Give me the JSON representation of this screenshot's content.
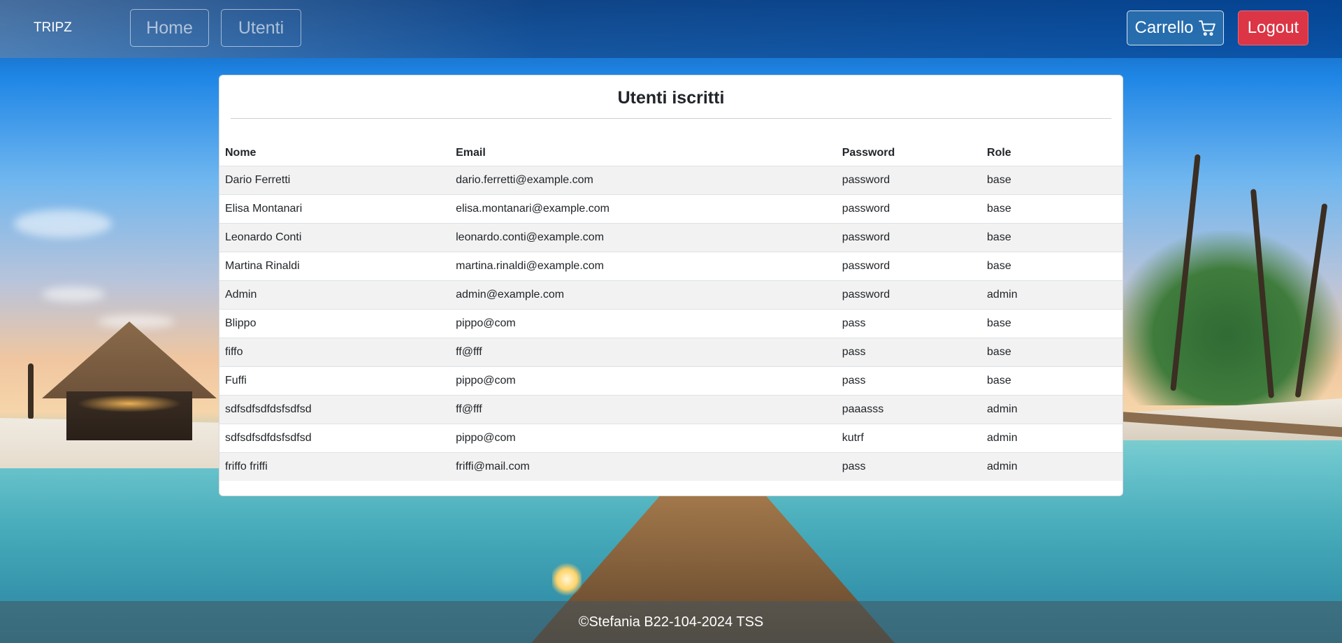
{
  "navbar": {
    "brand": "TRIPZ",
    "home_label": "Home",
    "utenti_label": "Utenti",
    "cart_label": "Carrello",
    "cart_icon": "cart-icon",
    "logout_label": "Logout",
    "logout_color": "#dc3545"
  },
  "main": {
    "title": "Utenti iscritti",
    "columns": [
      "Nome",
      "Email",
      "Password",
      "Role"
    ],
    "rows": [
      [
        "Dario Ferretti",
        "dario.ferretti@example.com",
        "password",
        "base"
      ],
      [
        "Elisa Montanari",
        "elisa.montanari@example.com",
        "password",
        "base"
      ],
      [
        "Leonardo Conti",
        "leonardo.conti@example.com",
        "password",
        "base"
      ],
      [
        "Martina Rinaldi",
        "martina.rinaldi@example.com",
        "password",
        "base"
      ],
      [
        "Admin",
        "admin@example.com",
        "password",
        "admin"
      ],
      [
        "Blippo",
        "pippo@com",
        "pass",
        "base"
      ],
      [
        "fiffo",
        "ff@fff",
        "pass",
        "base"
      ],
      [
        "Fuffi",
        "pippo@com",
        "pass",
        "base"
      ],
      [
        "sdfsdfsdfdsfsdfsd",
        "ff@fff",
        "paaasss",
        "admin"
      ],
      [
        "sdfsdfsdfdsfsdfsd",
        "pippo@com",
        "kutrf",
        "admin"
      ],
      [
        "friffo friffi",
        "friffi@mail.com",
        "pass",
        "admin"
      ]
    ]
  },
  "footer": {
    "text": "©Stefania B22-104-2024 TSS"
  }
}
